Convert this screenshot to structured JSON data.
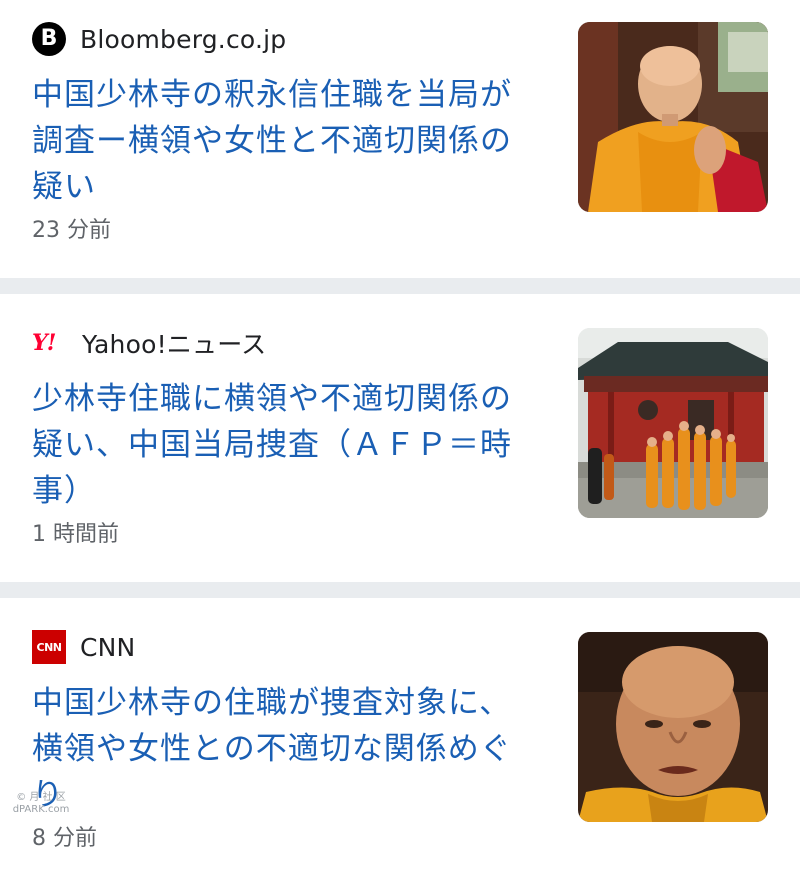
{
  "articles": [
    {
      "source": "Bloomberg.co.jp",
      "source_icon": "bloomberg-logo-icon",
      "logo_text": "B",
      "headline": "中国少林寺の釈永信住職を当局が調査ー横領や女性と不適切関係の疑い",
      "timestamp": "23 分前",
      "thumbnail": "monk-praying-photo"
    },
    {
      "source": "Yahoo!ニュース",
      "source_icon": "yahoo-logo-icon",
      "logo_text": "Y!",
      "headline": "少林寺住職に横領や不適切関係の疑い、中国当局捜査（ＡＦＰ＝時事）",
      "timestamp": "1 時間前",
      "thumbnail": "temple-procession-photo"
    },
    {
      "source": "CNN",
      "source_icon": "cnn-logo-icon",
      "logo_text": "CNN",
      "headline": "中国少林寺の住職が捜査対象に、横領や女性との不適切な関係めぐり",
      "timestamp": "8 分前",
      "thumbnail": "monk-portrait-photo"
    }
  ],
  "watermark": {
    "line1": "© 月 社 区",
    "line2": "dPARK.com"
  },
  "colors": {
    "headline": "#1a5fb4",
    "divider": "#e9ecef",
    "timestamp": "#5f6368",
    "yahoo_red": "#ff0033",
    "cnn_red": "#cc0000"
  }
}
